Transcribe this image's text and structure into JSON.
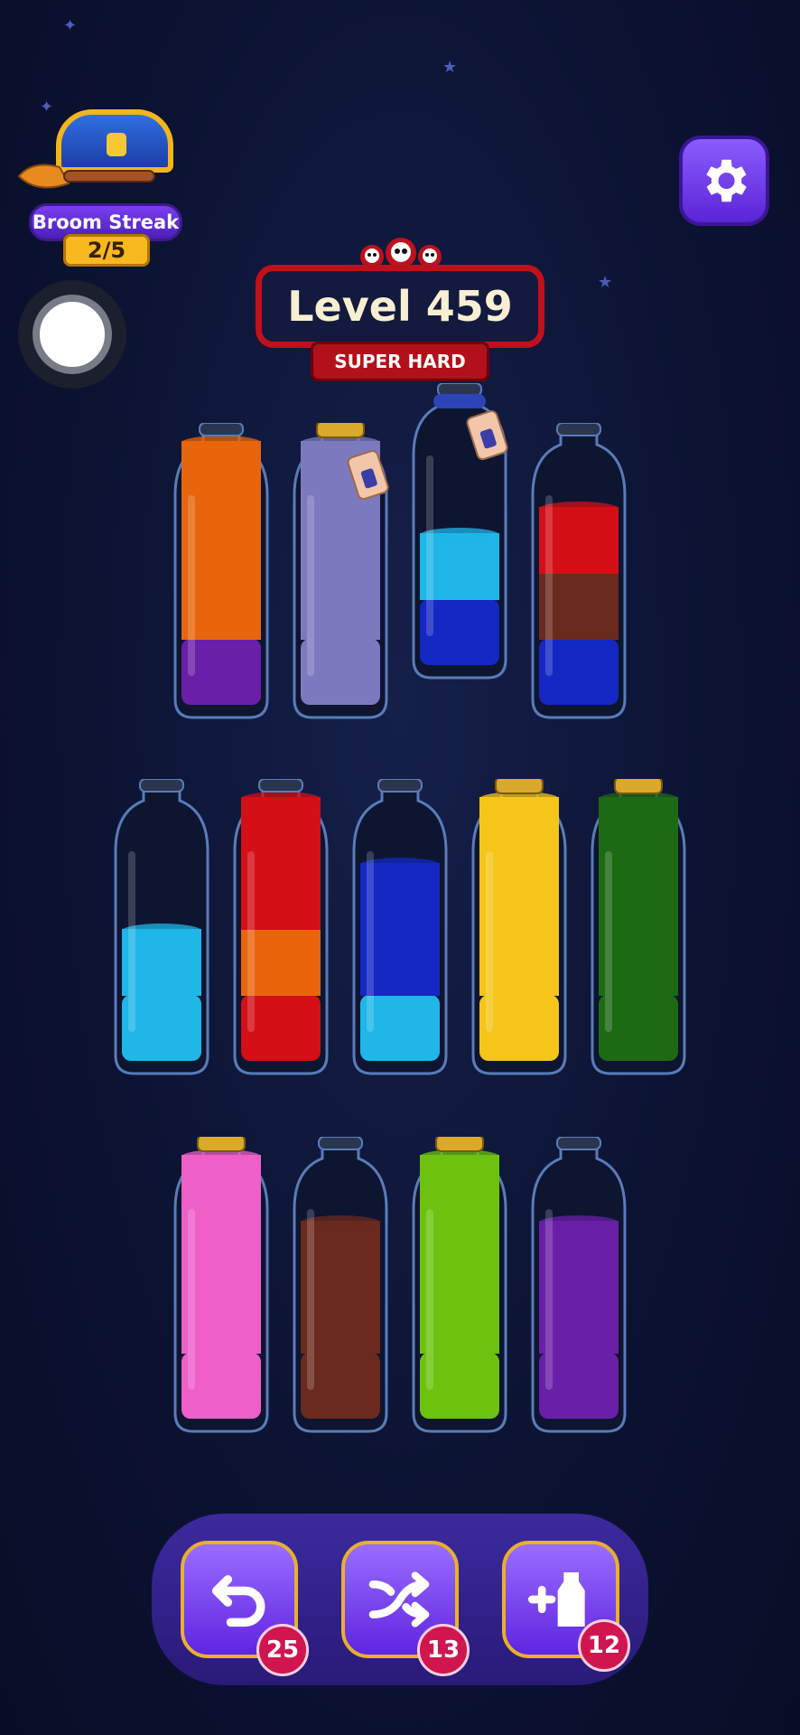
{
  "streak": {
    "title": "Broom Streak",
    "count": "2/5"
  },
  "level": {
    "title": "Level 459",
    "difficulty": "SUPER HARD"
  },
  "colors": {
    "orange": "#e8650b",
    "purple": "#6a1fa8",
    "lavender": "#7d79be",
    "lightblue": "#1fb6e8",
    "blue": "#1428c4",
    "red": "#d40f16",
    "brown": "#6b2a1e",
    "yellow": "#f6c51a",
    "green": "#1d6a14",
    "pink": "#ee5fc8",
    "lime": "#6cc20f"
  },
  "bottles": [
    {
      "row": 1,
      "cap": "none",
      "tag": false,
      "layers": [
        "purple",
        "orange",
        "orange",
        "orange"
      ]
    },
    {
      "row": 1,
      "cap": "cork",
      "tag": true,
      "layers": [
        "lavender",
        "lavender",
        "lavender",
        "lavender"
      ]
    },
    {
      "row": 1,
      "cap": "rope",
      "tag": true,
      "layers": [
        "blue",
        "lightblue"
      ]
    },
    {
      "row": 1,
      "cap": "none",
      "tag": false,
      "layers": [
        "blue",
        "brown",
        "red"
      ]
    },
    {
      "row": 2,
      "cap": "none",
      "tag": false,
      "layers": [
        "lightblue",
        "lightblue"
      ]
    },
    {
      "row": 2,
      "cap": "none",
      "tag": false,
      "layers": [
        "red",
        "orange",
        "red",
        "red"
      ]
    },
    {
      "row": 2,
      "cap": "none",
      "tag": false,
      "layers": [
        "lightblue",
        "blue",
        "blue"
      ]
    },
    {
      "row": 2,
      "cap": "cork",
      "tag": false,
      "layers": [
        "yellow",
        "yellow",
        "yellow",
        "yellow"
      ]
    },
    {
      "row": 2,
      "cap": "cork",
      "tag": false,
      "layers": [
        "green",
        "green",
        "green",
        "green"
      ]
    },
    {
      "row": 3,
      "cap": "cork",
      "tag": false,
      "layers": [
        "pink",
        "pink",
        "pink",
        "pink"
      ]
    },
    {
      "row": 3,
      "cap": "none",
      "tag": false,
      "layers": [
        "brown",
        "brown",
        "brown"
      ]
    },
    {
      "row": 3,
      "cap": "cork",
      "tag": false,
      "layers": [
        "lime",
        "lime",
        "lime",
        "lime"
      ]
    },
    {
      "row": 3,
      "cap": "none",
      "tag": false,
      "layers": [
        "purple",
        "purple",
        "purple"
      ]
    }
  ],
  "powerups": [
    {
      "name": "undo",
      "count": "25"
    },
    {
      "name": "shuffle",
      "count": "13"
    },
    {
      "name": "add-bottle",
      "count": "12"
    }
  ]
}
